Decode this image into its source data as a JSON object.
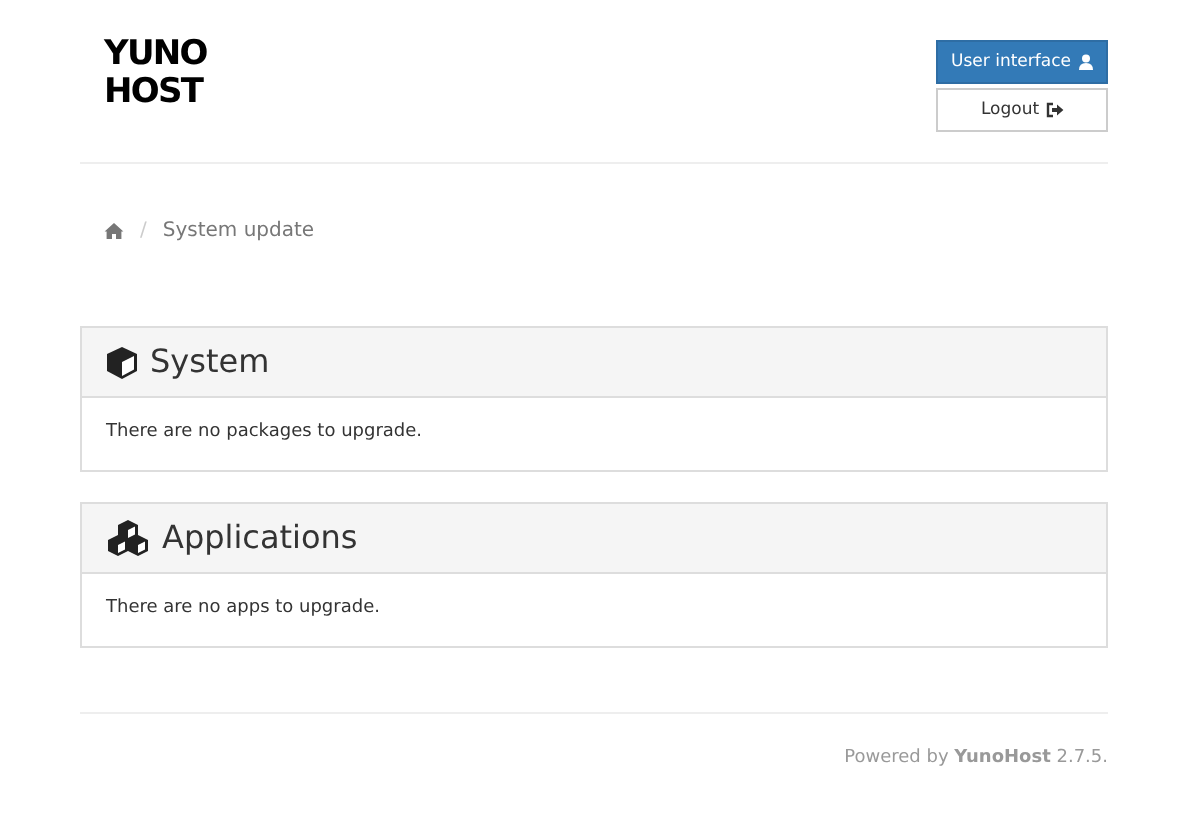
{
  "logo": {
    "lines": [
      "YUNO",
      "HOST"
    ]
  },
  "header_buttons": [
    {
      "label": "User interface",
      "kind": "user",
      "primary": true
    },
    {
      "label": "Logout",
      "kind": "logout",
      "primary": false
    }
  ],
  "breadcrumb": {
    "separator": "/",
    "items": [
      "System update"
    ]
  },
  "panels": [
    {
      "title": "System",
      "kind": "system",
      "message": "There are no packages to upgrade."
    },
    {
      "title": "Applications",
      "kind": "applications",
      "message": "There are no apps to upgrade."
    }
  ],
  "footer": "Powered by **YunoHost** 2.7.5."
}
